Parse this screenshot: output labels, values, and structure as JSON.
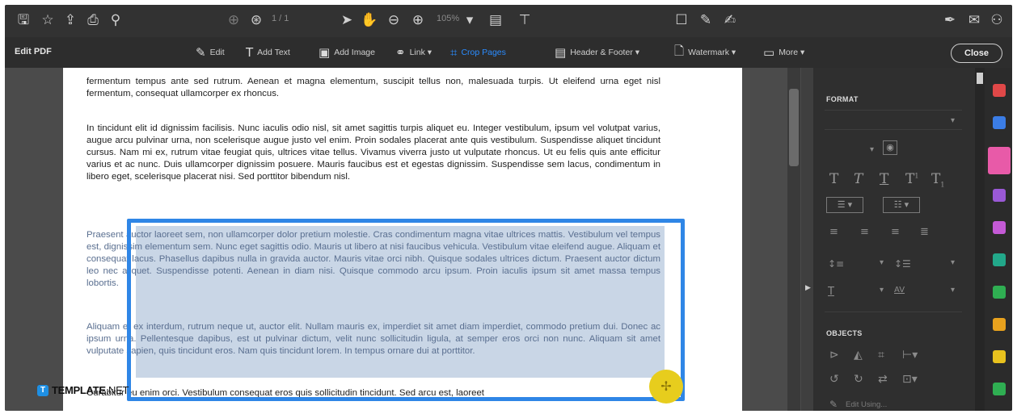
{
  "toolbar": {
    "page_indicator": "1 / 1",
    "zoom": "105%"
  },
  "edit_bar": {
    "title": "Edit PDF",
    "tools": [
      {
        "label": "Edit",
        "icon": "edit-icon"
      },
      {
        "label": "Add Text",
        "icon": "add-text-icon"
      },
      {
        "label": "Add Image",
        "icon": "add-image-icon"
      },
      {
        "label": "Link ▾",
        "icon": "link-icon"
      },
      {
        "label": "Crop Pages",
        "icon": "crop-pages-icon"
      },
      {
        "label": "Header & Footer ▾",
        "icon": "header-footer-icon"
      },
      {
        "label": "Watermark ▾",
        "icon": "watermark-icon"
      },
      {
        "label": "More ▾",
        "icon": "more-icon"
      }
    ],
    "close_label": "Close"
  },
  "document": {
    "paragraphs": [
      "fermentum tempus ante sed rutrum. Aenean et magna elementum, suscipit tellus non, malesuada turpis. Ut eleifend urna eget nisl fermentum, consequat ullamcorper ex rhoncus.",
      "In tincidunt elit id dignissim facilisis. Nunc iaculis odio nisl, sit amet sagittis turpis aliquet eu. Integer vestibulum, ipsum vel volutpat varius, augue arcu pulvinar urna, non scelerisque augue justo vel enim. Proin sodales placerat ante quis vestibulum. Suspendisse aliquet tincidunt cursus. Nam mi ex, rutrum vitae feugiat quis, ultrices vitae tellus. Vivamus viverra justo ut vulputate rhoncus. Ut eu felis quis ante efficitur varius et ac nunc. Duis ullamcorper dignissim posuere. Mauris faucibus est et egestas dignissim. Suspendisse sem lacus, condimentum in libero eget, scelerisque placerat nisi. Sed porttitor bibendum nisl.",
      "Praesent auctor laoreet sem, non ullamcorper dolor pretium molestie. Cras condimentum magna vitae ultrices mattis. Vestibulum vel tempus est, dignissim elementum sem. Nunc eget sagittis odio. Mauris ut libero at nisi faucibus vehicula. Vestibulum vitae eleifend augue. Aliquam et consequat lacus. Phasellus dapibus nulla in gravida auctor. Mauris vitae orci nibh. Quisque sodales ultrices dictum. Praesent auctor dictum leo nec aliquet. Suspendisse potenti. Aenean in diam nisi. Quisque commodo arcu ipsum. Proin iaculis ipsum sit amet massa tempus lobortis.",
      "Aliquam et ex interdum, rutrum neque ut, auctor elit. Nullam mauris ex, imperdiet sit amet diam imperdiet, commodo pretium dui. Donec ac ipsum urna. Pellentesque dapibus, est ut pulvinar dictum, velit nunc sollicitudin ligula, at semper eros orci non nunc. Aliquam sit amet vulputate sapien, quis tincidunt eros. Nam quis tincidunt lorem. In tempus ornare dui at porttitor.",
      "Curabitur eu enim orci. Vestibulum consequat eros quis sollicitudin tincidunt. Sed arcu est, laoreet"
    ]
  },
  "format_panel": {
    "format_heading": "FORMAT",
    "objects_heading": "OBJECTS",
    "edit_using_label": "Edit Using..."
  },
  "watermark": {
    "brand_main": "TEMPLATE",
    "brand_suffix": ".NET",
    "badge_letter": "T"
  },
  "colors": {
    "selection_border": "#2f86e6",
    "crop_active": "#2a8cff",
    "move_handle": "#e7cd1d"
  }
}
